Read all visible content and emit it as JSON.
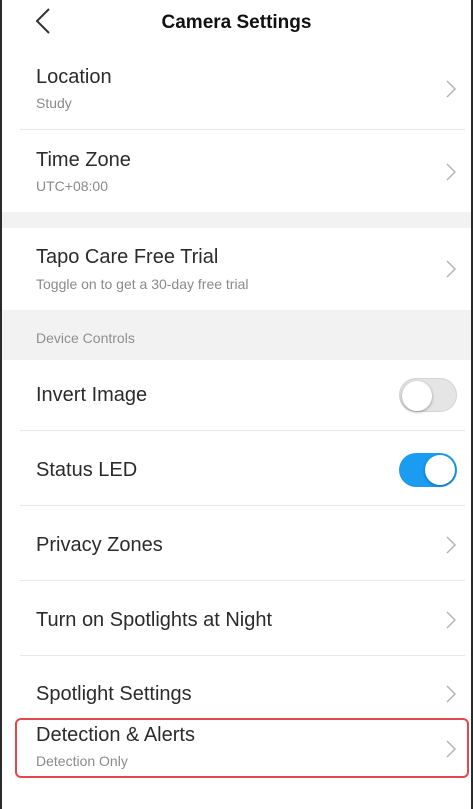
{
  "header": {
    "title": "Camera Settings",
    "back_icon": "chevron-left-icon"
  },
  "rows_top": [
    {
      "label": "Location",
      "sub": "Study"
    },
    {
      "label": "Time Zone",
      "sub": "UTC+08:00"
    }
  ],
  "trial": {
    "label": "Tapo Care Free Trial",
    "sub": "Toggle on to get a 30-day free trial"
  },
  "section": {
    "title": "Device Controls"
  },
  "controls": {
    "invert": {
      "label": "Invert Image",
      "state": "off"
    },
    "led": {
      "label": "Status LED",
      "state": "on"
    },
    "privacy": {
      "label": "Privacy Zones"
    },
    "spotlights": {
      "label": "Turn on Spotlights at Night"
    },
    "spotlight_settings": {
      "label": "Spotlight Settings"
    },
    "detection": {
      "label": "Detection & Alerts",
      "sub": "Detection Only"
    }
  },
  "colors": {
    "toggle_on": "#1a9df0",
    "highlight": "#e24a4a",
    "section_bg": "#f2f2f2"
  }
}
